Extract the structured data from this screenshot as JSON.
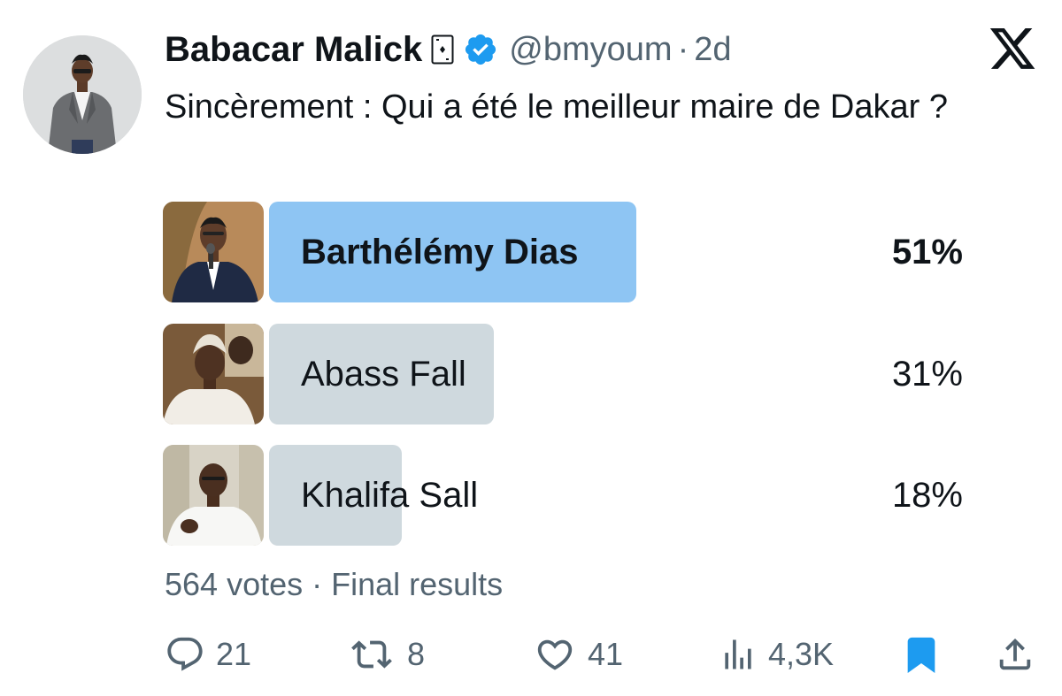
{
  "author": {
    "display_name": "Babacar Malick",
    "handle": "@bmyoum",
    "separator": "·",
    "time": "2d"
  },
  "tweet_text": "Sincèrement : Qui a été le meilleur maire de Dakar ?",
  "poll": {
    "options": [
      {
        "label": "Barthélémy Dias",
        "percent_text": "51%",
        "percent": 51,
        "winner": true
      },
      {
        "label": "Abass Fall",
        "percent_text": "31%",
        "percent": 31,
        "winner": false
      },
      {
        "label": "Khalifa Sall",
        "percent_text": "18%",
        "percent": 18,
        "winner": false
      }
    ],
    "meta": "564 votes · Final results"
  },
  "actions": {
    "replies": "21",
    "reposts": "8",
    "likes": "41",
    "views": "4,3K"
  },
  "colors": {
    "winner_bar": "#8ec5f3",
    "bar": "#cfd9de",
    "verified": "#1d9bf0",
    "bookmark": "#1d9bf0",
    "secondary_text": "#536471"
  },
  "icons": {
    "verified": "verified-badge-icon",
    "card": "playing-card-emoji-icon",
    "close": "x-logo-icon",
    "reply": "reply-icon",
    "repost": "repost-icon",
    "like": "heart-icon",
    "views": "views-icon",
    "bookmark": "bookmark-icon",
    "share": "share-icon"
  }
}
